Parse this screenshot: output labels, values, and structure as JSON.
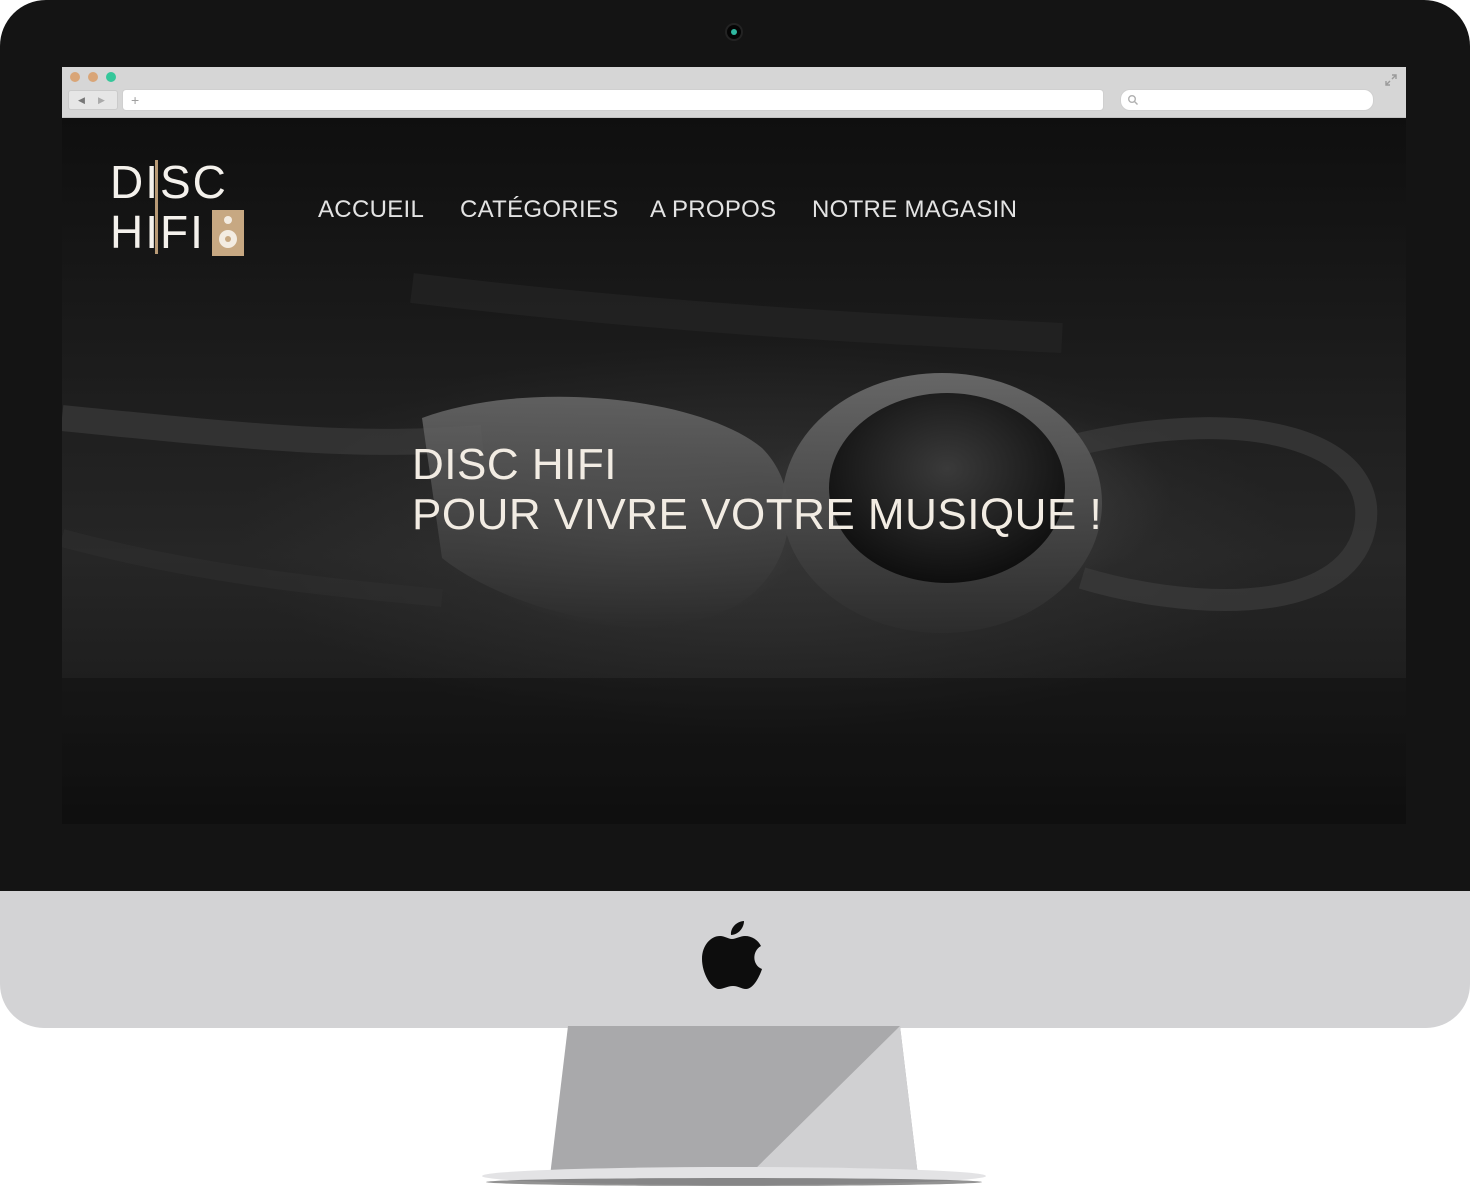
{
  "site": {
    "logo": {
      "line1": "DISC",
      "line2": "HIFI"
    },
    "nav": [
      {
        "label": "ACCUEIL"
      },
      {
        "label": "CATÉGORIES"
      },
      {
        "label": "A PROPOS"
      },
      {
        "label": "NOTRE MAGASIN"
      }
    ],
    "hero": {
      "line1": "DISC HIFI",
      "line2": "POUR VIVRE VOTRE MUSIQUE !"
    }
  },
  "colors": {
    "accent_gold": "#c7a882",
    "bezel": "#141414",
    "chin": "#d3d3d5"
  },
  "icons": [
    "camera-icon",
    "back-arrow-icon",
    "forward-arrow-icon",
    "plus-icon",
    "search-icon",
    "expand-icon",
    "apple-logo-icon",
    "speaker-icon"
  ]
}
